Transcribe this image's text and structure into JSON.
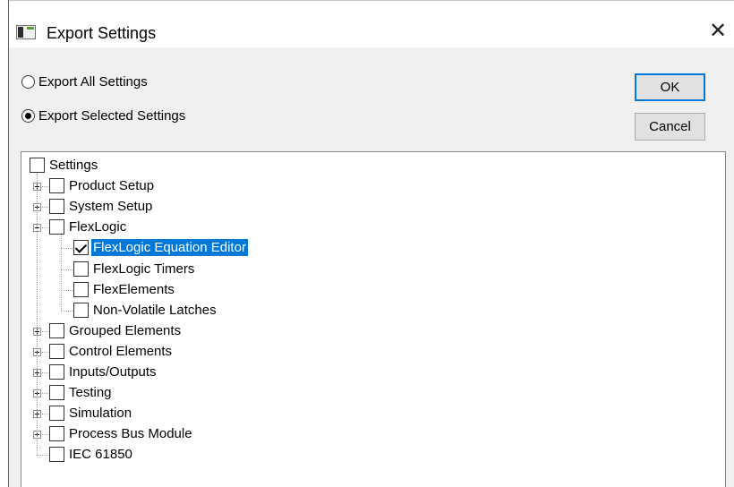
{
  "window": {
    "title": "Export Settings"
  },
  "options": {
    "export_all": "Export All Settings",
    "export_selected": "Export Selected Settings",
    "selected": "export_selected"
  },
  "buttons": {
    "ok": "OK",
    "cancel": "Cancel"
  },
  "tree": {
    "root": "Settings",
    "items": [
      {
        "label": "Product Setup",
        "state": "collapsed",
        "checked": false
      },
      {
        "label": "System Setup",
        "state": "collapsed",
        "checked": false
      },
      {
        "label": "FlexLogic",
        "state": "expanded",
        "checked": false,
        "children": [
          {
            "label": "FlexLogic Equation Editor",
            "checked": true,
            "selected": true
          },
          {
            "label": "FlexLogic Timers",
            "checked": false
          },
          {
            "label": "FlexElements",
            "checked": false
          },
          {
            "label": "Non-Volatile Latches",
            "checked": false
          }
        ]
      },
      {
        "label": "Grouped Elements",
        "state": "collapsed",
        "checked": false
      },
      {
        "label": "Control Elements",
        "state": "collapsed",
        "checked": false
      },
      {
        "label": "Inputs/Outputs",
        "state": "collapsed",
        "checked": false
      },
      {
        "label": "Testing",
        "state": "collapsed",
        "checked": false
      },
      {
        "label": "Simulation",
        "state": "collapsed",
        "checked": false
      },
      {
        "label": "Process Bus Module",
        "state": "collapsed",
        "checked": false
      },
      {
        "label": "IEC 61850",
        "state": "leaf",
        "checked": false
      }
    ]
  }
}
